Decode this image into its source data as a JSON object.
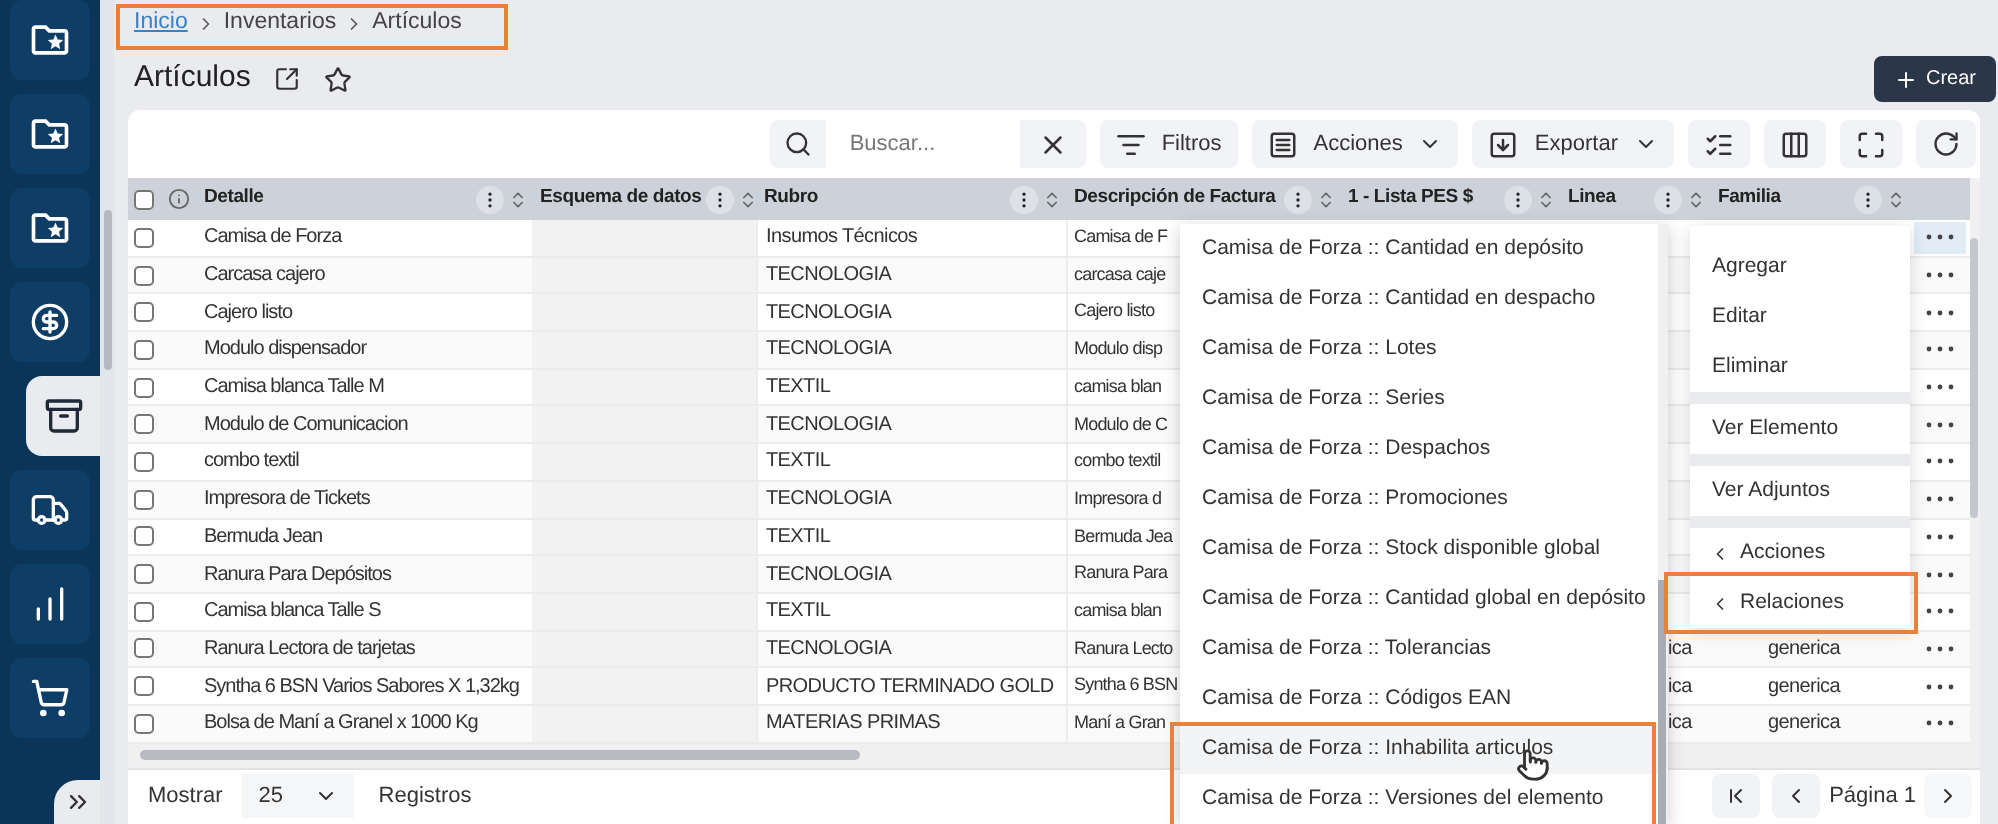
{
  "sidebar": {
    "items": [
      {
        "kind": "folder-star",
        "selected": false
      },
      {
        "kind": "folder-star",
        "selected": false
      },
      {
        "kind": "folder-star",
        "selected": false
      },
      {
        "kind": "dollar",
        "selected": false
      },
      {
        "kind": "archive",
        "selected": true
      },
      {
        "kind": "truck",
        "selected": false
      },
      {
        "kind": "chart",
        "selected": false
      },
      {
        "kind": "cart",
        "selected": false
      }
    ]
  },
  "breadcrumb": [
    {
      "label": "Inicio",
      "kind": "link"
    },
    {
      "label": "Inventarios",
      "kind": "text"
    },
    {
      "label": "Artículos",
      "kind": "text"
    }
  ],
  "page_title": "Artículos",
  "create_button": "Crear",
  "toolbar": {
    "search": {
      "placeholder": "Buscar..."
    },
    "buttons": [
      {
        "label": "Filtros",
        "kind": "filter"
      },
      {
        "label": "Acciones",
        "kind": "actions"
      },
      {
        "label": "Exportar",
        "kind": "export"
      }
    ]
  },
  "table": {
    "select_all": {
      "checked": false
    },
    "columns": [
      "Detalle",
      "Esquema de datos",
      "Rubro",
      "Descripción de Factura",
      "1 - Lista PES $",
      "Linea",
      "Familia"
    ],
    "rows": [
      {
        "checked": false,
        "menu_open": true,
        "detalle": "Camisa de Forza",
        "rubro": "Insumos Técnicos",
        "descripcion": "Camisa de F"
      },
      {
        "checked": false,
        "menu_open": false,
        "detalle": "Carcasa cajero",
        "rubro": "TECNOLOGIA",
        "descripcion": "carcasa caje"
      },
      {
        "checked": false,
        "menu_open": false,
        "detalle": "Cajero listo",
        "rubro": "TECNOLOGIA",
        "descripcion": "Cajero listo"
      },
      {
        "checked": false,
        "menu_open": false,
        "detalle": "Modulo dispensador",
        "rubro": "TECNOLOGIA",
        "descripcion": "Modulo disp"
      },
      {
        "checked": false,
        "menu_open": false,
        "detalle": "Camisa blanca Talle M",
        "rubro": "TEXTIL",
        "descripcion": "camisa blan"
      },
      {
        "checked": false,
        "menu_open": false,
        "detalle": "Modulo de Comunicacion",
        "rubro": "TECNOLOGIA",
        "descripcion": "Modulo de C"
      },
      {
        "checked": false,
        "menu_open": false,
        "detalle": "combo textil",
        "rubro": "TEXTIL",
        "descripcion": "combo textil"
      },
      {
        "checked": false,
        "menu_open": false,
        "detalle": "Impresora de Tickets",
        "rubro": "TECNOLOGIA",
        "descripcion": "Impresora d"
      },
      {
        "checked": false,
        "menu_open": false,
        "detalle": "Bermuda Jean",
        "rubro": "TEXTIL",
        "descripcion": "Bermuda Jea"
      },
      {
        "checked": false,
        "menu_open": false,
        "detalle": "Ranura Para Depósitos",
        "rubro": "TECNOLOGIA",
        "descripcion": "Ranura Para"
      },
      {
        "checked": false,
        "menu_open": false,
        "detalle": "Camisa blanca Talle S",
        "rubro": "TEXTIL",
        "descripcion": "camisa blan"
      },
      {
        "checked": false,
        "menu_open": false,
        "detalle": "Ranura Lectora de tarjetas",
        "rubro": "TECNOLOGIA",
        "descripcion": "Ranura Lecto",
        "linea": "ica",
        "familia": "generica"
      },
      {
        "checked": false,
        "menu_open": false,
        "detalle": "Syntha 6 BSN Varios Sabores X 1,32kg",
        "rubro": "PRODUCTO TERMINADO GOLD",
        "descripcion": "Syntha 6 BSN",
        "linea": "ica",
        "familia": "generica"
      },
      {
        "checked": false,
        "menu_open": false,
        "detalle": "Bolsa de Maní a Granel x 1000 Kg",
        "rubro": "MATERIAS PRIMAS",
        "descripcion": "Maní a Gran",
        "linea": "ica",
        "familia": "generica"
      }
    ]
  },
  "relations_menu": [
    {
      "label": "Camisa de Forza :: Cantidad en depósito",
      "selected": false
    },
    {
      "label": "Camisa de Forza :: Cantidad en despacho",
      "selected": false
    },
    {
      "label": "Camisa de Forza :: Lotes",
      "selected": false
    },
    {
      "label": "Camisa de Forza :: Series",
      "selected": false
    },
    {
      "label": "Camisa de Forza :: Despachos",
      "selected": false
    },
    {
      "label": "Camisa de Forza :: Promociones",
      "selected": false
    },
    {
      "label": "Camisa de Forza :: Stock disponible global",
      "selected": false
    },
    {
      "label": "Camisa de Forza :: Cantidad global en depósito",
      "selected": false
    },
    {
      "label": "Camisa de Forza :: Tolerancias",
      "selected": false
    },
    {
      "label": "Camisa de Forza :: Códigos EAN",
      "selected": false
    },
    {
      "label": "Camisa de Forza :: Inhabilita articulos",
      "selected": true
    },
    {
      "label": "Camisa de Forza :: Versiones del elemento",
      "selected": false
    }
  ],
  "context_menu": {
    "groups": [
      [
        {
          "label": "Agregar",
          "kind": "item"
        },
        {
          "label": "Editar",
          "kind": "item"
        },
        {
          "label": "Eliminar",
          "kind": "item"
        }
      ],
      [
        {
          "label": "Ver Elemento",
          "kind": "item"
        }
      ],
      [
        {
          "label": "Ver Adjuntos",
          "kind": "item"
        }
      ],
      [
        {
          "label": "Acciones",
          "kind": "submenu"
        },
        {
          "label": "Relaciones",
          "kind": "submenu"
        }
      ]
    ]
  },
  "footer": {
    "show_label": "Mostrar",
    "page_size": "25",
    "records_label": "Registros",
    "page_label": "Página 1"
  }
}
